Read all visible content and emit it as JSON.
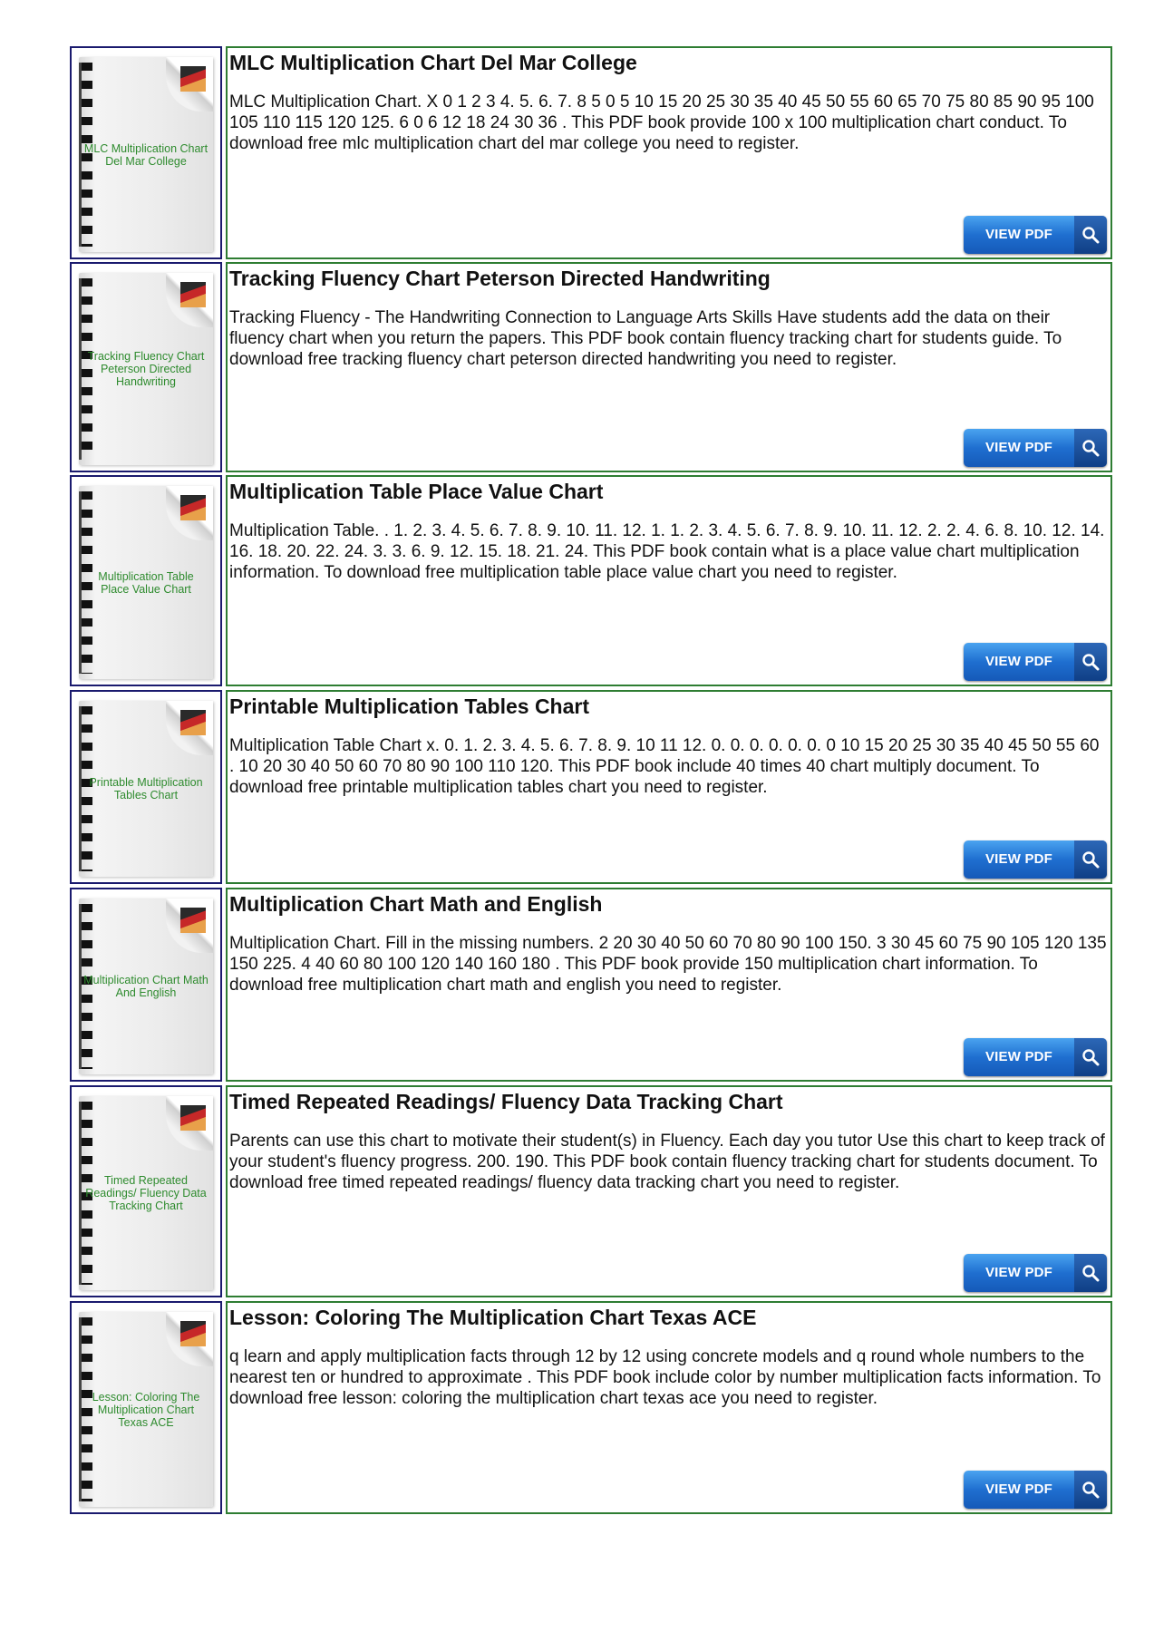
{
  "button_label": "VIEW PDF",
  "colors": {
    "thumb_border": "#1a1a6e",
    "content_border": "#2e7d32",
    "thumb_label": "#2e8b2e",
    "button_blue": "#1f6fd0"
  },
  "items": [
    {
      "thumb_label": "MLC Multiplication Chart Del Mar College",
      "title": "MLC Multiplication Chart Del Mar College",
      "description": "MLC Multiplication Chart. X 0 1 2 3 4. 5. 6. 7. 8 5 0 5 10 15 20 25 30 35 40 45 50 55 60 65 70 75 80 85 90 95 100 105 110 115 120 125. 6 0 6 12 18 24 30 36 . This PDF book provide 100 x 100 multiplication chart conduct. To download free mlc multiplication chart del mar college you need to register."
    },
    {
      "thumb_label": "Tracking Fluency Chart Peterson Directed Handwriting",
      "title": "Tracking Fluency Chart Peterson Directed Handwriting",
      "description": "Tracking Fluency - The Handwriting Connection to Language Arts Skills Have students add the data on their fluency chart when you return the papers. This PDF book contain fluency tracking chart for students guide. To download free tracking fluency chart peterson directed handwriting you need to register."
    },
    {
      "thumb_label": "Multiplication Table Place Value Chart",
      "title": "Multiplication Table Place Value Chart",
      "description": "Multiplication Table. . 1. 2. 3. 4. 5. 6. 7. 8. 9. 10. 11. 12. 1. 1. 2. 3. 4. 5. 6. 7. 8. 9. 10. 11. 12. 2. 2. 4. 6. 8. 10. 12. 14. 16. 18. 20. 22. 24. 3. 3. 6. 9. 12. 15. 18. 21. 24. This PDF book contain what is a place value chart multiplication information. To download free multiplication table place value chart you need to register."
    },
    {
      "thumb_label": "Printable Multiplication Tables Chart",
      "title": "Printable Multiplication Tables Chart",
      "description": "Multiplication Table Chart x. 0. 1. 2. 3. 4. 5. 6. 7. 8. 9. 10 11 12. 0. 0. 0. 0. 0. 0. 0 10 15 20 25 30 35 40 45 50 55 60 . 10 20 30 40 50 60 70 80 90 100 110 120. This PDF book include 40 times 40 chart multiply document. To download free printable multiplication tables chart you need to register."
    },
    {
      "thumb_label": "Multiplication Chart Math And English",
      "title": "Multiplication Chart Math and English",
      "description": "Multiplication Chart. Fill in the missing numbers. 2 20 30 40 50 60 70 80 90 100 150. 3 30 45 60 75 90 105 120 135 150 225. 4 40 60 80 100 120 140 160 180 . This PDF book provide 150 multiplication chart information. To download free multiplication chart math and english you need to register."
    },
    {
      "thumb_label": "Timed Repeated Readings/ Fluency Data Tracking Chart",
      "title": "Timed Repeated Readings/ Fluency Data Tracking Chart",
      "description": "Parents can use this chart to motivate their student(s) in Fluency. Each day you tutor Use this chart to keep track of your student's fluency progress. 200. 190. This PDF book contain fluency tracking chart for students document. To download free timed repeated readings/ fluency data tracking chart you need to register."
    },
    {
      "thumb_label": "Lesson: Coloring The Multiplication Chart Texas ACE",
      "title": "Lesson: Coloring The Multiplication Chart Texas ACE",
      "description": "q learn and apply multiplication facts through 12 by 12 using concrete models and q round whole numbers to the nearest ten or hundred to approximate . This PDF book include color by number multiplication facts information. To download free lesson: coloring the multiplication chart texas ace you need to register."
    }
  ]
}
